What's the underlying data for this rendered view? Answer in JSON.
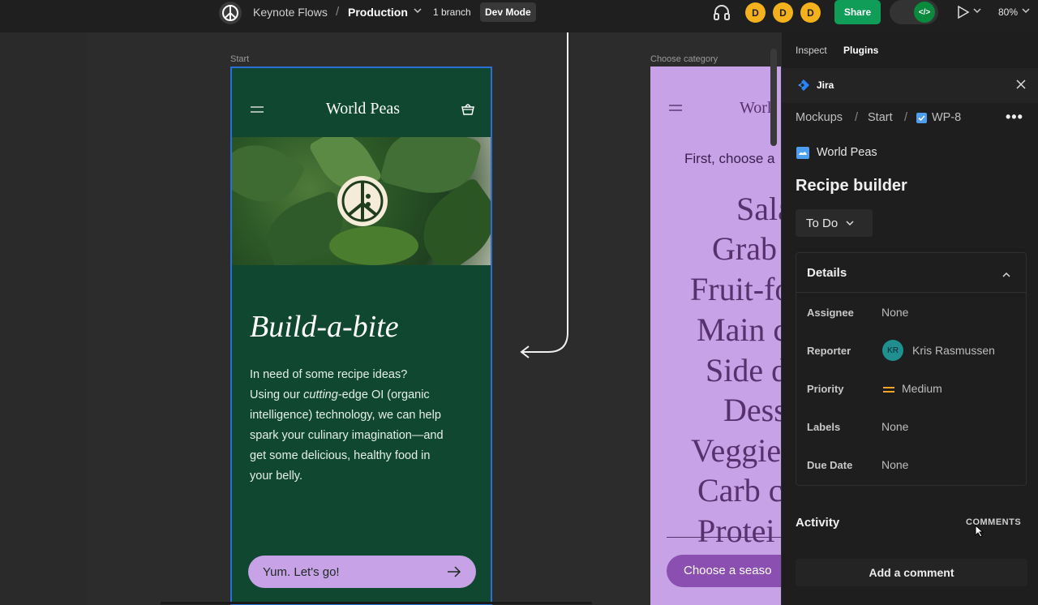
{
  "topbar": {
    "project": "Keynote Flows",
    "separator": "/",
    "page": "Production",
    "branch": "1 branch",
    "dev_mode": "Dev Mode",
    "avatars": [
      "D",
      "D",
      "D"
    ],
    "share": "Share",
    "zoom": "80%"
  },
  "canvas": {
    "frame1_label": "Start",
    "frame2_label": "Choose category",
    "frame1": {
      "brand": "World Peas",
      "headline": "Build-a-bite",
      "body_lines": [
        "In need of some recipe ideas?",
        "Using our cutting-edge OI (organic",
        "intelligence) technology, we can help",
        "spark your culinary imagination—and",
        "get some delicious, healthy food in",
        "your belly."
      ],
      "body_line2_pre": "Using our ",
      "body_line2_em": "cutting",
      "body_line2_post": "-edge OI (organic",
      "cta": "Yum. Let's go!"
    },
    "frame2": {
      "brand_partial": "Worl",
      "prompt_partial": "First, choose a",
      "categories": [
        "Sala",
        "Grab",
        "Fruit-fo",
        "Main c",
        "Side d",
        "Dess",
        "Veggie",
        "Carb c",
        "Protei"
      ],
      "cta_partial": "Choose a seaso"
    }
  },
  "panel": {
    "tabs": [
      "Inspect",
      "Plugins"
    ],
    "plugin_name": "Jira",
    "breadcrumb": [
      "Mockups",
      "Start",
      "WP-8"
    ],
    "breadcrumb_sep": "/",
    "project": "World Peas",
    "issue_title": "Recipe builder",
    "status": "To Do",
    "details_title": "Details",
    "fields": [
      {
        "label": "Assignee",
        "value": "None"
      },
      {
        "label": "Reporter",
        "value": "Kris Rasmussen",
        "initials": "KR"
      },
      {
        "label": "Priority",
        "value": "Medium"
      },
      {
        "label": "Labels",
        "value": "None"
      },
      {
        "label": "Due Date",
        "value": "None"
      }
    ],
    "activity_title": "Activity",
    "comments_label": "COMMENTS",
    "add_comment": "Add a comment"
  },
  "colors": {
    "frame1_bg": "#0f4730",
    "frame2_bg": "#c8a2e6",
    "accent_green": "#0f9d58",
    "avatar_yellow": "#f3b21b",
    "selection_blue": "#2a6fd6"
  }
}
